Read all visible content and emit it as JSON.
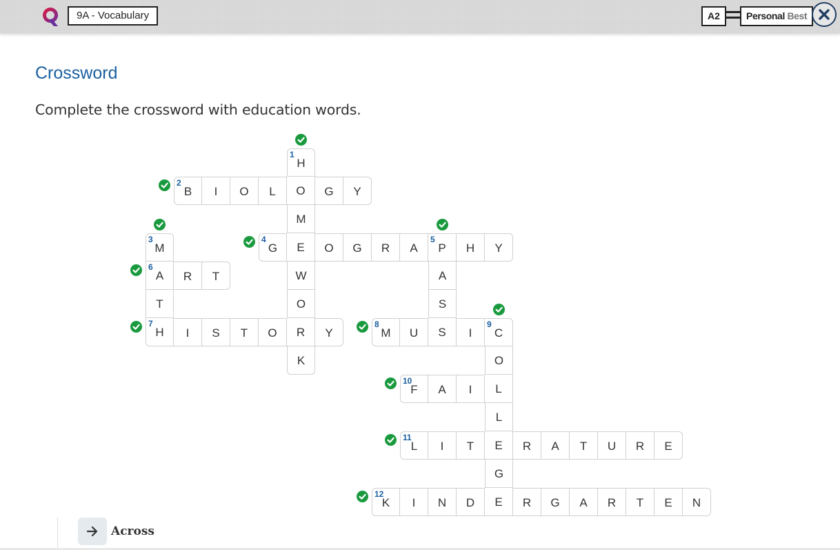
{
  "header": {
    "unit_title": "9A - Vocabulary",
    "level": "A2",
    "brand_part1": "Personal ",
    "brand_part2": "Best",
    "close_icon": "close-icon",
    "logo_icon": "app-logo-icon"
  },
  "exercise": {
    "title": "Crossword",
    "instructions": "Complete the crossword with education words."
  },
  "colors": {
    "accent": "#1a5fa0",
    "check": "#1a9a3e",
    "logo_red": "#e0183c",
    "logo_purple": "#6a2fa0"
  },
  "crossword": {
    "words": [
      {
        "num": "1",
        "dir": "down",
        "answer": "HOMEWORK",
        "row": 0,
        "col": 5,
        "correct": true
      },
      {
        "num": "2",
        "dir": "across",
        "answer": "BIOLOGY",
        "row": 1,
        "col": 1,
        "correct": true
      },
      {
        "num": "3",
        "dir": "down",
        "answer": "MATH",
        "row": 3,
        "col": 0,
        "correct": true
      },
      {
        "num": "4",
        "dir": "across",
        "answer": "GEOGRAPHY",
        "row": 3,
        "col": 4,
        "correct": true
      },
      {
        "num": "5",
        "dir": "down",
        "answer": "PASS",
        "row": 3,
        "col": 10,
        "correct": true
      },
      {
        "num": "6",
        "dir": "across",
        "answer": "ART",
        "row": 4,
        "col": 0,
        "correct": true
      },
      {
        "num": "7",
        "dir": "across",
        "answer": "HISTORY",
        "row": 6,
        "col": 0,
        "correct": true
      },
      {
        "num": "8",
        "dir": "across",
        "answer": "MUSIC",
        "row": 6,
        "col": 8,
        "correct": true
      },
      {
        "num": "9",
        "dir": "down",
        "answer": "COLLEGE",
        "row": 6,
        "col": 12,
        "correct": true
      },
      {
        "num": "10",
        "dir": "across",
        "answer": "FAIL",
        "row": 8,
        "col": 9,
        "correct": true
      },
      {
        "num": "11",
        "dir": "across",
        "answer": "LITERATURE",
        "row": 10,
        "col": 9,
        "correct": true
      },
      {
        "num": "12",
        "dir": "across",
        "answer": "KINDERGARTEN",
        "row": 12,
        "col": 8,
        "correct": true
      }
    ]
  },
  "footer": {
    "across_label": "Across",
    "across_icon": "arrow-right-icon"
  }
}
